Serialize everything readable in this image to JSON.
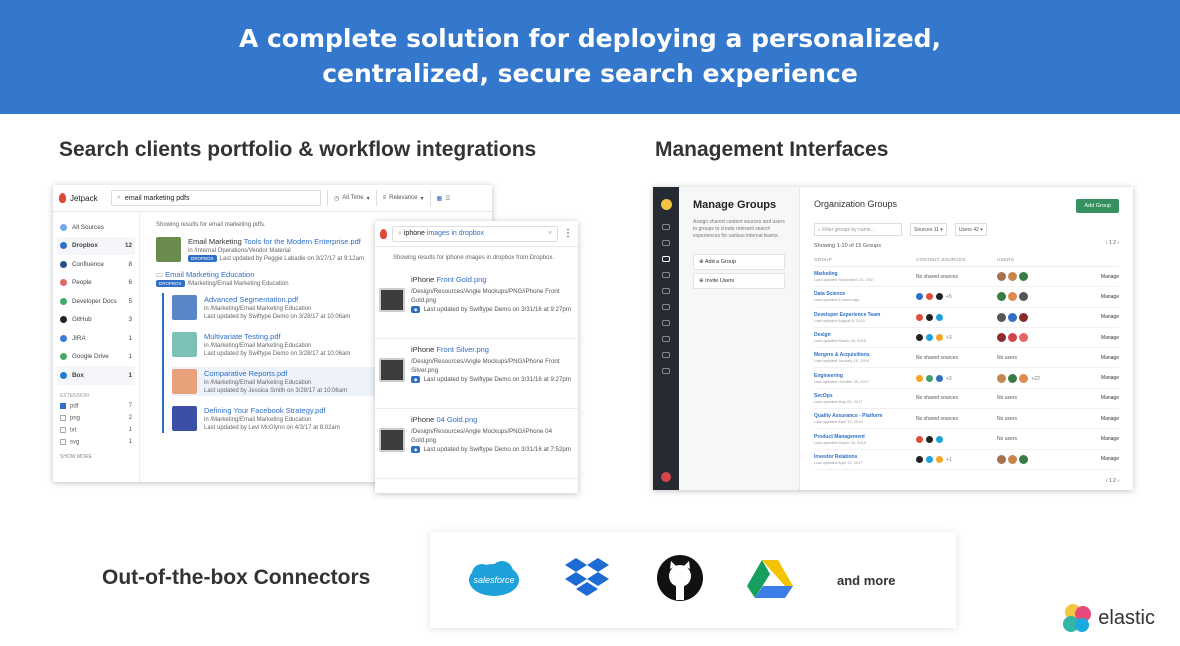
{
  "banner": {
    "line1": "A complete solution for deploying a personalized,",
    "line2": "centralized, secure search experience"
  },
  "sections": {
    "search": "Search clients portfolio & workflow integrations",
    "management": "Management Interfaces",
    "connectors": "Out-of-the-box Connectors"
  },
  "jetpack": {
    "brand": "Jetpack",
    "query": "email marketing pdfs",
    "filter_time": "All Time",
    "filter_sort": "Relevance",
    "sources": [
      {
        "label": "All Sources",
        "count": "",
        "color": "#7aa7e6"
      },
      {
        "label": "Dropbox",
        "count": "12",
        "color": "#2f6fc6"
      },
      {
        "label": "Confluence",
        "count": "8",
        "color": "#2a4d8f"
      },
      {
        "label": "People",
        "count": "6",
        "color": "#e86565"
      },
      {
        "label": "Developer Docs",
        "count": "5",
        "color": "#46a76a"
      },
      {
        "label": "GitHub",
        "count": "3",
        "color": "#222"
      },
      {
        "label": "JIRA",
        "count": "1",
        "color": "#3b7ad6"
      },
      {
        "label": "Google Drive",
        "count": "1",
        "color": "#49a964"
      },
      {
        "label": "Box",
        "count": "1",
        "color": "#1f7dd6"
      }
    ],
    "extension_label": "EXTENSION",
    "extensions": [
      {
        "label": "pdf",
        "count": "7"
      },
      {
        "label": "png",
        "count": "2"
      },
      {
        "label": "txt",
        "count": "1"
      },
      {
        "label": "svg",
        "count": "1"
      }
    ],
    "show_more": "SHOW MORE",
    "showing": "Showing results for email marketing pdfs.",
    "top_result": {
      "title_a": "Email Marketing",
      "title_b": " Tools for the Modern Enterprise.pdf",
      "path": "in /Internal Operations/Vendor Material",
      "tag": "DROPBOX",
      "updated": "Last updated by Peggie Labadie on 3/27/17 at 9:12am"
    },
    "folder": {
      "title": "Email Marketing Education",
      "tag": "DROPBOX",
      "path": "/Marketing/Email Marketing Education"
    },
    "sub_results": [
      {
        "title": "Advanced Segmentation.pdf",
        "path": "in /Marketing/Email Marketing Education",
        "updated": "Last updated by Swiftype Demo on 3/28/17 at 10:06am",
        "color": "#5a86c9"
      },
      {
        "title": "Multivariate Testing.pdf",
        "path": "in /Marketing/Email Marketing Education",
        "updated": "Last updated by Swiftype Demo on 3/28/17 at 10:06am",
        "color": "#7cc0b8"
      },
      {
        "title": "Comparative Reports.pdf",
        "path": "in /Marketing/Email Marketing Education",
        "updated": "Last updated by Jessica Smith on 3/28/17 at 10:06am",
        "color": "#e9a17c"
      },
      {
        "title": "Defining Your Facebook Strategy.pdf",
        "path": "in /Marketing/Email Marketing Education",
        "updated": "Last updated by Levi McGlynn on 4/3/17 at 8:02am",
        "color": "#3a4fa5"
      }
    ]
  },
  "dropbox_panel": {
    "query_a": "iphone ",
    "query_b": "images in dropbox",
    "showing": "Showing results for iphone images in dropbox from Dropbox.",
    "results": [
      {
        "t1": "iPhone",
        "t2": " Front Gold.png",
        "path": "/Design/Resources/Angle Mockups/PNG/iPhone Front Gold.png",
        "path2": "in /Design/Resources/Angle Mockups/PNG",
        "updated": "Last updated by Swiftype Demo on 3/31/16 at 9:27pm"
      },
      {
        "t1": "iPhone",
        "t2": " Front Silver.png",
        "path": "/Design/Resources/Angle Mockups/PNG/iPhone Front Silver.png",
        "path2": "in /Design/Resources/Angle Mockups/PNG",
        "updated": "Last updated by Swiftype Demo on 3/31/16 at 9:27pm"
      },
      {
        "t1": "iPhone",
        "t2": " 04 Gold.png",
        "path": "/Design/Resources/Angle Mockups/PNG/iPhone 04 Gold.png",
        "path2": "in /Design/Resources/Angle Mockups/PNG",
        "updated": "Last updated by Swiftype Demo on 3/31/16 at 7:52pm"
      }
    ]
  },
  "manage": {
    "heading": "Manage Groups",
    "desc": "Assign shared content sources and users to groups to create relevant search experiences for various internal teams.",
    "actions": [
      "Add a Group",
      "Invite Users"
    ],
    "title": "Organization Groups",
    "add_btn": "Add Group",
    "filter_placeholder": "Filter groups by name...",
    "sources_dd": "Sources 11",
    "users_dd": "Users 42",
    "showing": "Showing 1-10 of 15 Groups",
    "pager": "1  2",
    "headers": [
      "GROUP",
      "CONTENT SOURCES",
      "USERS",
      ""
    ],
    "manage_label": "Manage",
    "rows": [
      {
        "name": "Marketing",
        "date": "Last updated September 22, 2017",
        "sources": "No shared sources",
        "users": "avatars"
      },
      {
        "name": "Data Science",
        "date": "Last updated 8 hours ago",
        "sources": "icons +5",
        "users": "avatars"
      },
      {
        "name": "Developer Experience Team",
        "date": "Last updated August 8, 2019",
        "sources": "icons",
        "users": "avatars"
      },
      {
        "name": "Design",
        "date": "Last updated March 26, 2019",
        "sources": "icons +3",
        "users": "avatars"
      },
      {
        "name": "Mergers & Acquisitions",
        "date": "Last updated January 19, 2019",
        "sources": "No shared sources",
        "users": "No users"
      },
      {
        "name": "Engineering",
        "date": "Last updated October 25, 2017",
        "sources": "icons +3",
        "users": "avatars +22"
      },
      {
        "name": "SecOps",
        "date": "Last updated May 29, 2017",
        "sources": "No shared sources",
        "users": "No users"
      },
      {
        "name": "Quality Assurance - Platform",
        "date": "Last updated April 19, 2019",
        "sources": "No shared sources",
        "users": "No users"
      },
      {
        "name": "Product Management",
        "date": "Last updated March 26, 2019",
        "sources": "icons",
        "users": "No users"
      },
      {
        "name": "Investor Relations",
        "date": "Last updated April 13, 2017",
        "sources": "icons +1",
        "users": "avatars"
      }
    ]
  },
  "connectors": {
    "salesforce": "salesforce",
    "more": "and more"
  },
  "elastic": "elastic",
  "colors": {
    "banner": "#3378cc",
    "accent": "#2f6fc6",
    "green": "#37905f"
  }
}
